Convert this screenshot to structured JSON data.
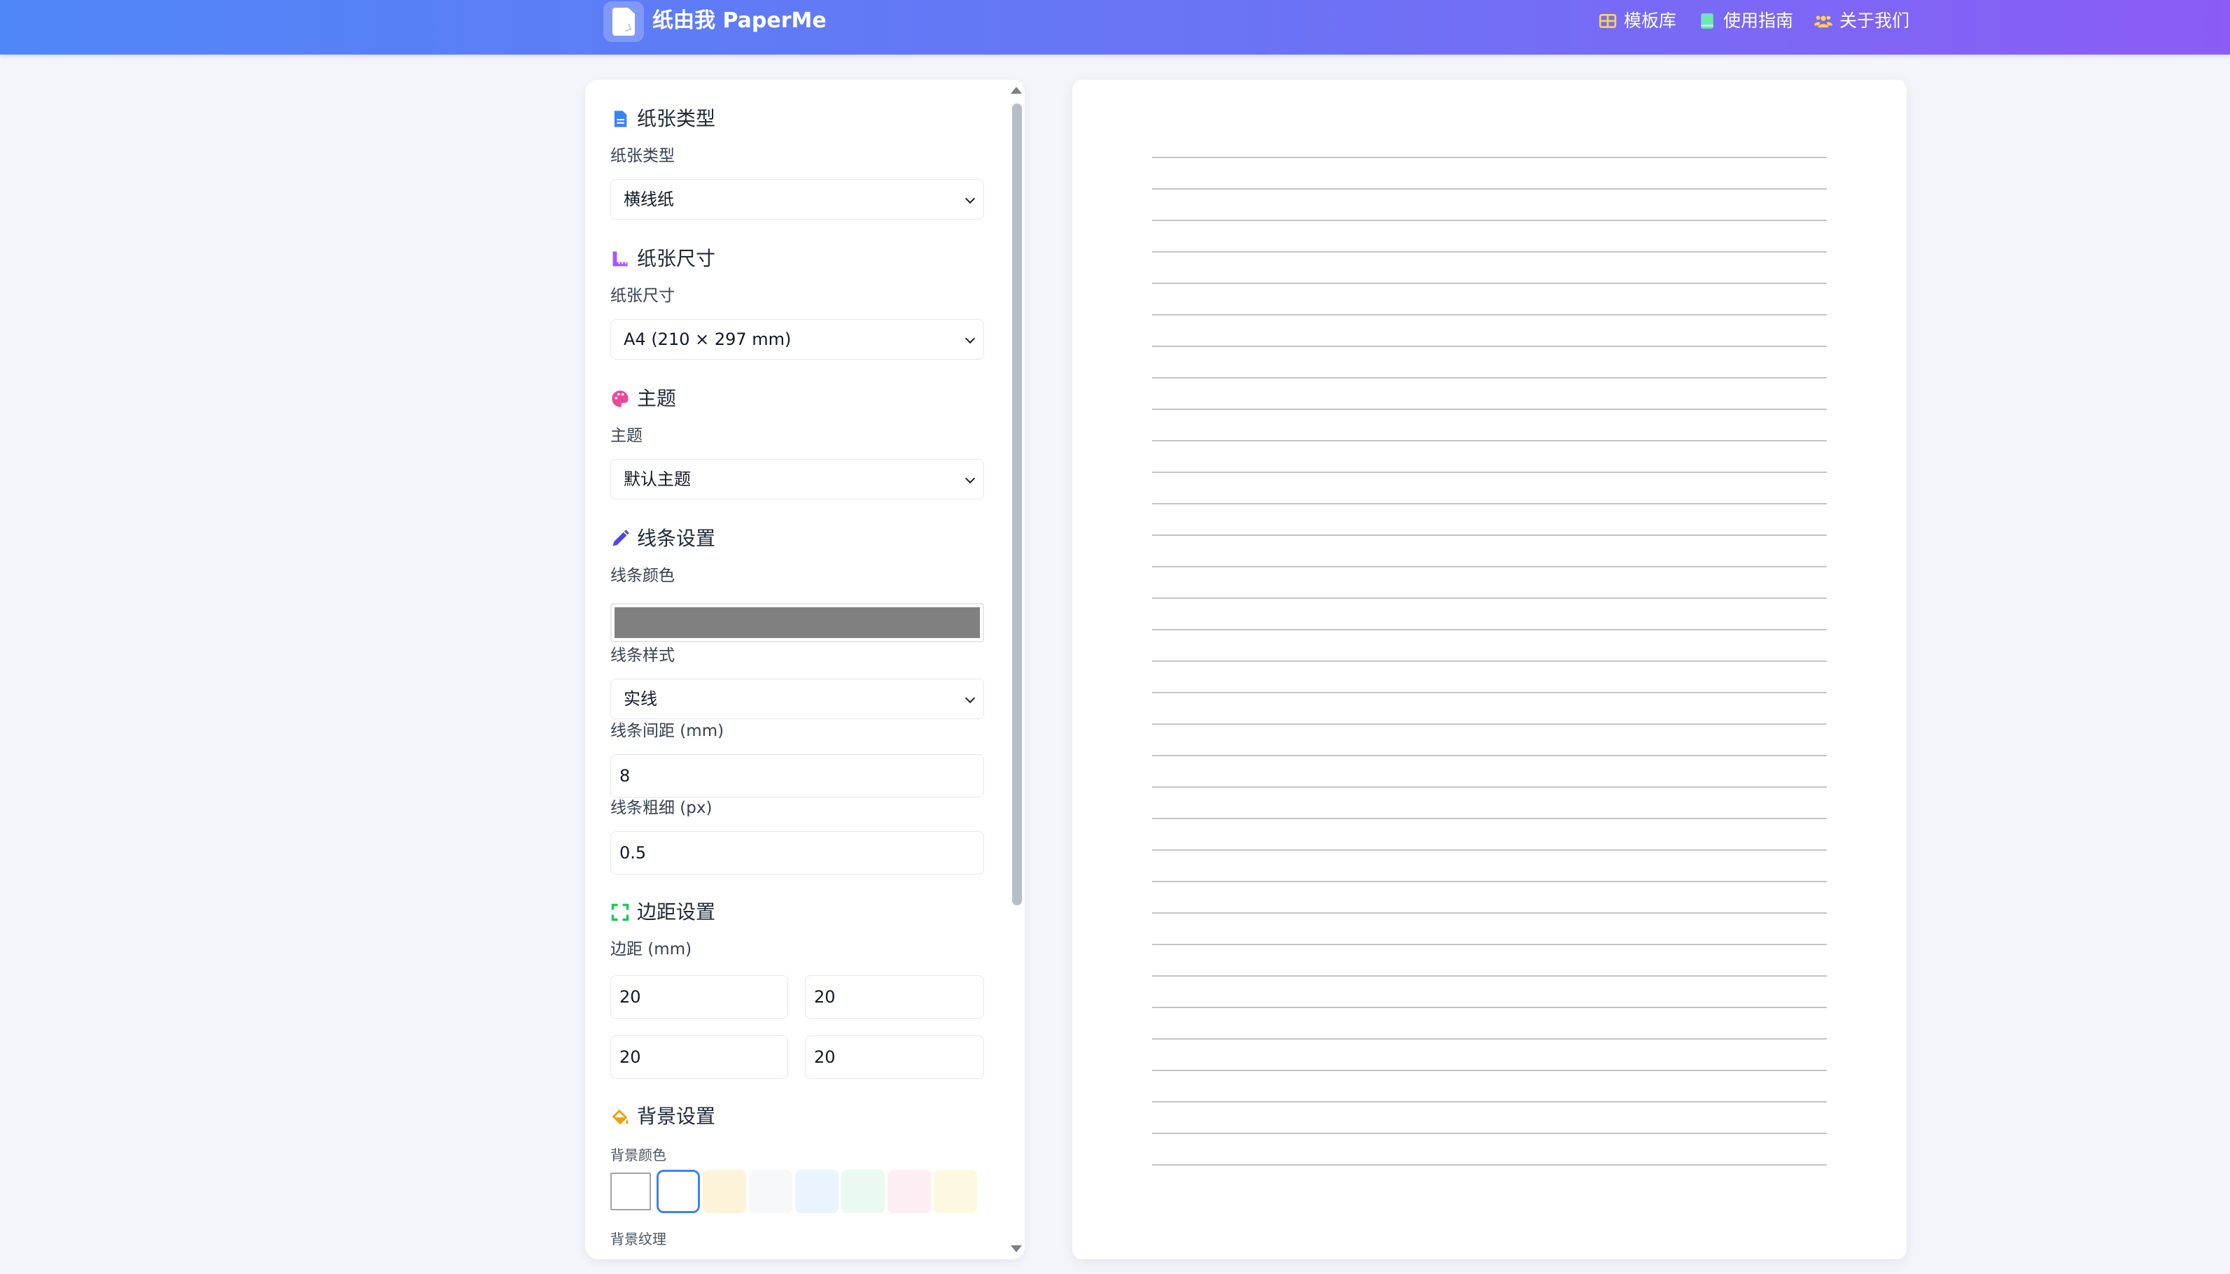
{
  "header": {
    "brand": "纸由我 PaperMe",
    "nav": [
      {
        "label": "模板库",
        "icon": "grid-icon",
        "color": "#fcd34d"
      },
      {
        "label": "使用指南",
        "icon": "book-icon",
        "color": "#6ee7b7"
      },
      {
        "label": "关于我们",
        "icon": "users-icon",
        "color": "#fcd34d"
      }
    ],
    "gradient": [
      "#4f86f7",
      "#8b5cf6"
    ]
  },
  "sidebar": {
    "paper_type": {
      "title": "纸张类型",
      "label": "纸张类型",
      "value": "横线纸",
      "icon": "file-icon",
      "icon_color": "#3b82f6"
    },
    "paper_size": {
      "title": "纸张尺寸",
      "label": "纸张尺寸",
      "value": "A4 (210 × 297 mm)",
      "icon": "ruler-icon",
      "icon_color": "#a855f7"
    },
    "theme": {
      "title": "主题",
      "label": "主题",
      "value": "默认主题",
      "icon": "palette-icon",
      "icon_color": "#ec4899"
    },
    "line": {
      "title": "线条设置",
      "icon": "pencil-icon",
      "icon_color": "#4f46e5",
      "color_label": "线条颜色",
      "color_value": "#808080",
      "style_label": "线条样式",
      "style_value": "实线",
      "spacing_label": "线条间距 (mm)",
      "spacing_value": "8",
      "width_label": "线条粗细 (px)",
      "width_value": "0.5"
    },
    "margin": {
      "title": "边距设置",
      "icon": "expand-icon",
      "icon_color": "#22c55e",
      "label": "边距 (mm)",
      "values": [
        "20",
        "20",
        "20",
        "20"
      ]
    },
    "background": {
      "title": "背景设置",
      "icon": "paint-bucket-icon",
      "icon_color": "#f59e0b",
      "color_label": "背景颜色",
      "texture_label": "背景纹理",
      "colors": [
        "#ffffff",
        "#ffffff",
        "#fdf3d9",
        "#f7f8fa",
        "#eaf4ff",
        "#eafaf0",
        "#fdeef3",
        "#fdf9e1"
      ],
      "selected_index": 1
    }
  },
  "preview": {
    "line_color": "#c5c5c5",
    "line_count": 33
  }
}
